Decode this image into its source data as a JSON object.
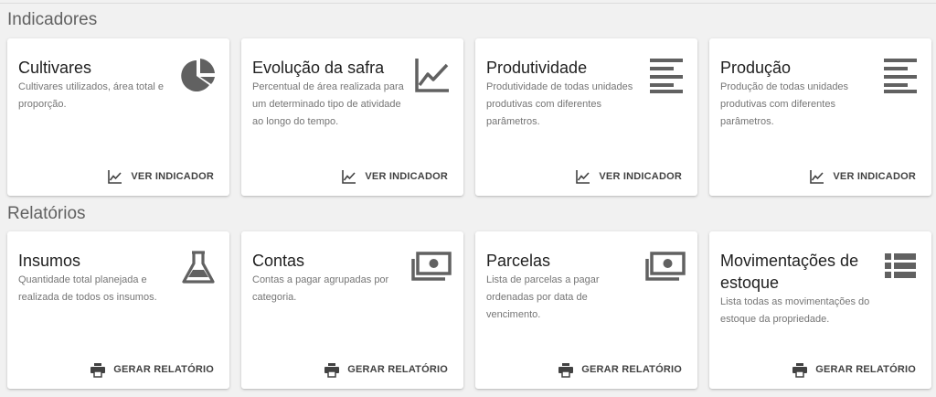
{
  "sections": {
    "indicators": {
      "title": "Indicadores",
      "cards": [
        {
          "title": "Cultivares",
          "description": "Cultivares utilizados, área total e proporção.",
          "icon": "pie-chart-icon",
          "action": "VER INDICADOR"
        },
        {
          "title": "Evolução da safra",
          "description": "Percentual de área realizada para um determinado tipo de atividade ao longo do tempo.",
          "icon": "line-chart-icon",
          "action": "VER INDICADOR"
        },
        {
          "title": "Produtividade",
          "description": "Produtividade de todas unidades produtivas com diferentes parâmetros.",
          "icon": "align-lines-icon",
          "action": "VER INDICADOR"
        },
        {
          "title": "Produção",
          "description": "Produção de todas unidades produtivas com diferentes parâmetros.",
          "icon": "align-lines-icon",
          "action": "VER INDICADOR"
        }
      ]
    },
    "reports": {
      "title": "Relatórios",
      "cards": [
        {
          "title": "Insumos",
          "description": "Quantidade total planejada e realizada de todos os insumos.",
          "icon": "flask-icon",
          "action": "GERAR RELATÓRIO"
        },
        {
          "title": "Contas",
          "description": "Contas a pagar agrupadas por categoria.",
          "icon": "money-icon",
          "action": "GERAR RELATÓRIO"
        },
        {
          "title": "Parcelas",
          "description": "Lista de parcelas a pagar ordenadas por data de vencimento.",
          "icon": "money-icon",
          "action": "GERAR RELATÓRIO"
        },
        {
          "title": "Movimentações de estoque",
          "description": "Lista todas as movimentações do estoque da propriedade.",
          "icon": "list-icon",
          "action": "GERAR RELATÓRIO"
        }
      ]
    }
  },
  "colors": {
    "background": "#f1f1f1",
    "card": "#ffffff",
    "icon": "#616161",
    "title": "#212121",
    "description": "#757575"
  }
}
